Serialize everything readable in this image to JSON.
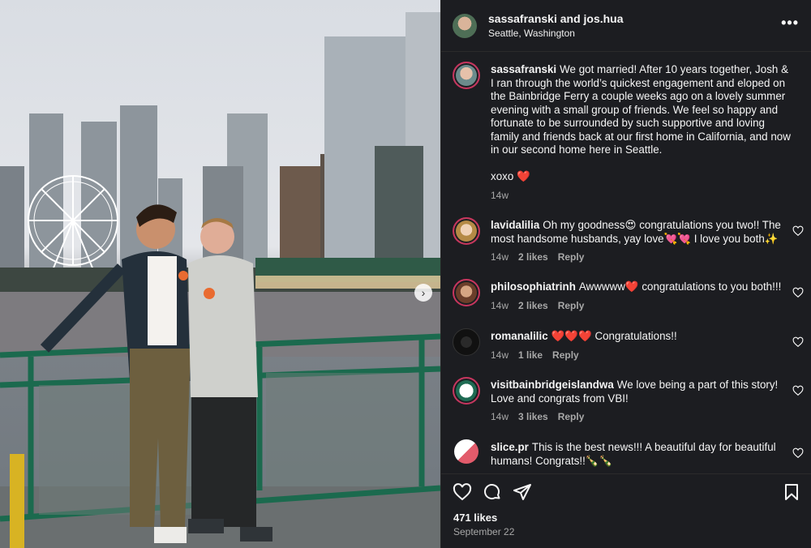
{
  "post": {
    "author": "sassafranski and jos.hua",
    "location": "Seattle, Washington",
    "caption": {
      "username": "sassafranski",
      "text": "We got married! After 10 years together, Josh & I ran through the world’s quickest engagement and eloped on the Bainbridge Ferry a couple weeks ago on a lovely summer evening with a small group of friends. We feel so happy and fortunate to be surrounded by such supportive and loving family and friends back at our first home in California, and now in our second home here in Seattle.",
      "signoff": "xoxo ❤️",
      "time": "14w"
    },
    "comments": [
      {
        "username": "lavidalilia",
        "text": "Oh my goodness😍 congratulations you two!! The most handsome husbands, yay love💘💘 I love you both✨",
        "time": "14w",
        "likes": "2 likes",
        "reply": "Reply"
      },
      {
        "username": "philosophiatrinh",
        "text": "Awwwww❤️ congratulations to you both!!!",
        "time": "14w",
        "likes": "2 likes",
        "reply": "Reply"
      },
      {
        "username": "romanalilic",
        "text": "❤️❤️❤️ Congratulations!!",
        "time": "14w",
        "likes": "1 like",
        "reply": "Reply"
      },
      {
        "username": "visitbainbridgeislandwa",
        "text": "We love being a part of this story! Love and congrats from VBI!",
        "time": "14w",
        "likes": "3 likes",
        "reply": "Reply"
      },
      {
        "username": "slice.pr",
        "text": "This is the best news!!! A beautiful day for beautiful humans! Congrats!!🍾🍾",
        "time": "",
        "likes": "",
        "reply": ""
      }
    ],
    "likes": "471 likes",
    "date": "September 22"
  },
  "icons": {
    "like": "heart-icon",
    "comment": "comment-icon",
    "share": "send-icon",
    "save": "bookmark-icon",
    "more": "more-options-icon",
    "next": "chevron-right-icon"
  },
  "colors": {
    "accent_heart": "#ff3040",
    "story_ring": "#c7355e",
    "panel_bg": "#1c1d21"
  }
}
